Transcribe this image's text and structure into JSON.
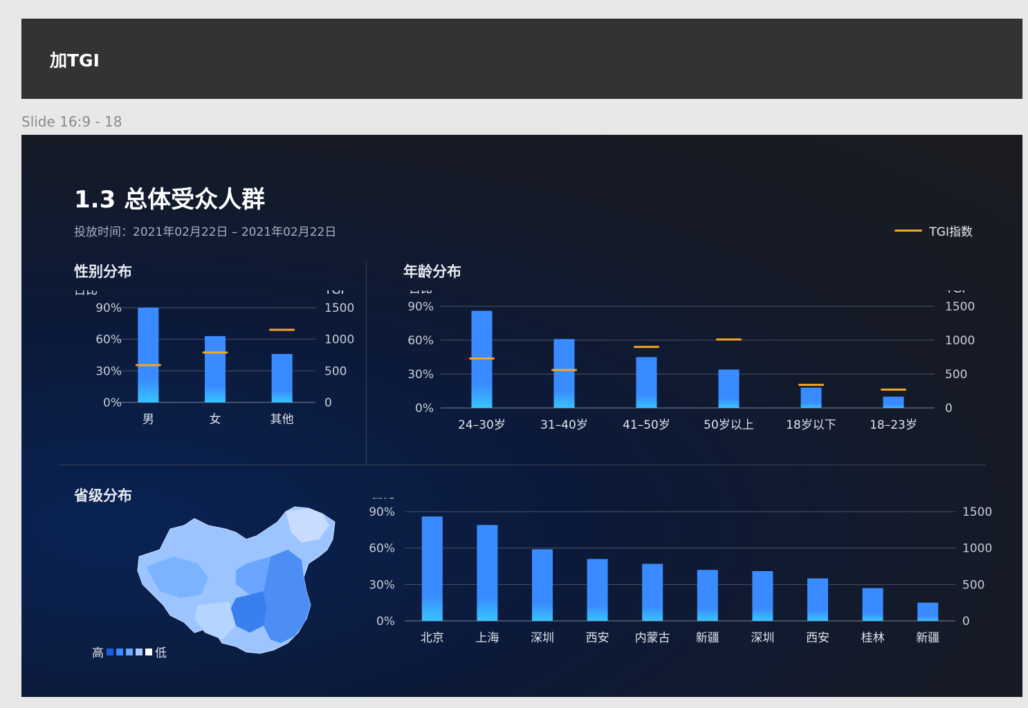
{
  "topbar": {
    "title": "加TGI"
  },
  "frame_label": "Slide 16:9 - 18",
  "slide": {
    "title": "1.3 总体受众人群",
    "subtitle": "投放时间：2021年02月22日 –  2021年02月22日",
    "legend_label": "TGI指数",
    "colors": {
      "bar": "#3a8bff",
      "tgi": "#f5a623"
    }
  },
  "sections": {
    "gender": "性别分布",
    "age": "年龄分布",
    "province": "省级分布"
  },
  "map_legend": {
    "high": "高",
    "low": "低"
  },
  "chart_data": [
    {
      "type": "bar",
      "name": "gender",
      "categories": [
        "男",
        "女",
        "其他"
      ],
      "values": [
        90,
        63,
        46
      ],
      "tgi": [
        590,
        790,
        1150
      ],
      "ylabel": "占比",
      "y2label": "TGI",
      "yticks": [
        "90%",
        "60%",
        "30%",
        "0%"
      ],
      "y2ticks": [
        "1500",
        "1000",
        "500",
        "0"
      ],
      "ylim": [
        0,
        90
      ],
      "y2lim": [
        0,
        1500
      ]
    },
    {
      "type": "bar",
      "name": "age",
      "categories": [
        "24–30岁",
        "31–40岁",
        "41–50岁",
        "50岁以上",
        "18岁以下",
        "18–23岁"
      ],
      "values": [
        86,
        61,
        45,
        34,
        18,
        10
      ],
      "tgi": [
        730,
        560,
        900,
        1010,
        340,
        270
      ],
      "ylabel": "占比",
      "y2label": "TGI",
      "yticks": [
        "90%",
        "60%",
        "30%",
        "0%"
      ],
      "y2ticks": [
        "1500",
        "1000",
        "500",
        "0"
      ],
      "ylim": [
        0,
        90
      ],
      "y2lim": [
        0,
        1500
      ]
    },
    {
      "type": "bar",
      "name": "province",
      "categories": [
        "北京",
        "上海",
        "深圳",
        "西安",
        "内蒙古",
        "新疆",
        "深圳",
        "西安",
        "桂林",
        "新疆"
      ],
      "values": [
        86,
        79,
        59,
        51,
        47,
        42,
        41,
        35,
        27,
        15
      ],
      "ylabel": "占比",
      "y2label": "TGI",
      "yticks": [
        "90%",
        "60%",
        "30%",
        "0%"
      ],
      "y2ticks": [
        "1500",
        "1000",
        "500",
        "0"
      ],
      "ylim": [
        0,
        90
      ],
      "y2lim": [
        0,
        1500
      ]
    }
  ]
}
